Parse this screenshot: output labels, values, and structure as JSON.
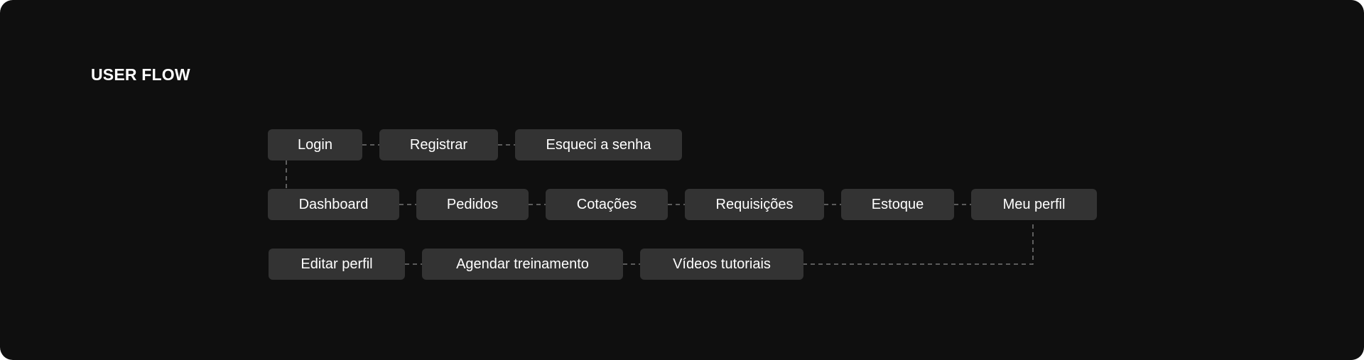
{
  "title": "USER FLOW",
  "colors": {
    "background": "#0f0f0f",
    "node_fill": "#333333",
    "connector": "#8a8a8a",
    "text": "#ffffff"
  },
  "flow": {
    "row1": [
      "Login",
      "Registrar",
      "Esqueci a senha"
    ],
    "row2": [
      "Dashboard",
      "Pedidos",
      "Cotações",
      "Requisições",
      "Estoque",
      "Meu perfil"
    ],
    "row3": [
      "Editar perfil",
      "Agendar treinamento",
      "Vídeos tutoriais"
    ]
  }
}
